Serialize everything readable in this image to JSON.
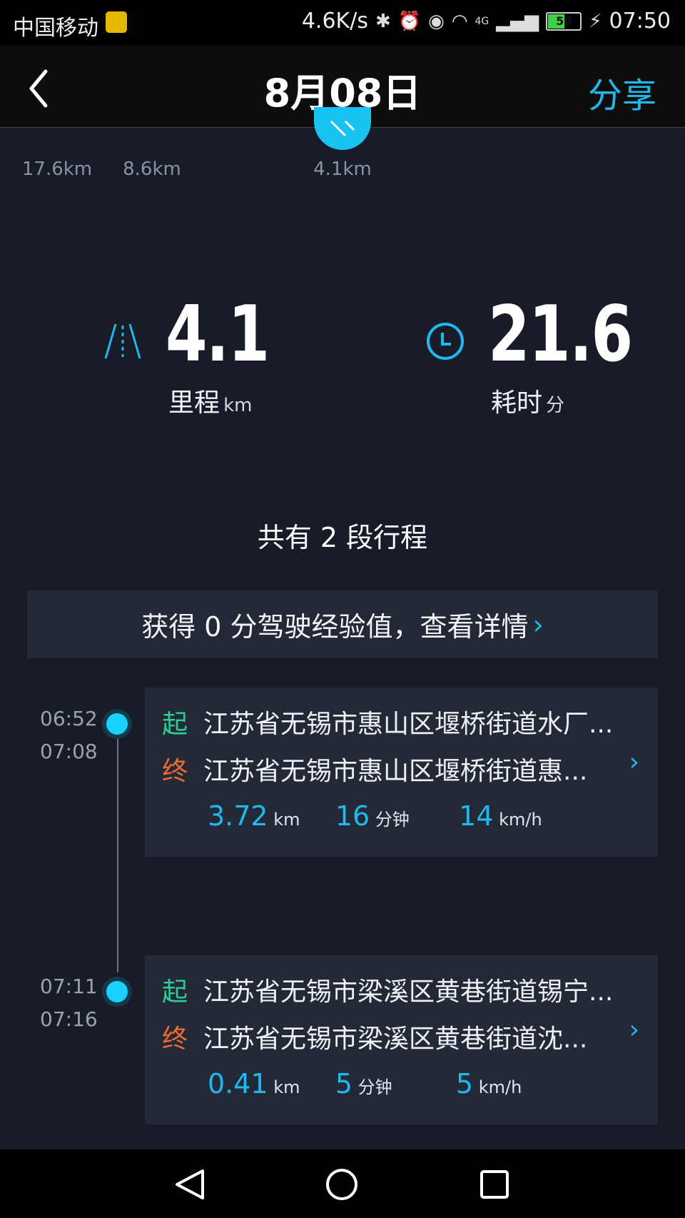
{
  "status_bar": {
    "carrier": "中国移动",
    "speed": "4.6K/s",
    "network": "4G",
    "battery": "50",
    "time": "07:50"
  },
  "header": {
    "title": "8月08日",
    "share_label": "分享"
  },
  "day_strip": [
    {
      "distance": "17.6km"
    },
    {
      "distance": "8.6km"
    },
    {
      "distance": ""
    },
    {
      "distance": "4.1km",
      "selected": true
    }
  ],
  "summary": {
    "distance_value": "4.1",
    "distance_label": "里程",
    "distance_unit": "km",
    "duration_value": "21.6",
    "duration_label": "耗时",
    "duration_unit": "分"
  },
  "segments_text": "共有 2 段行程",
  "experience_text": "获得 0 分驾驶经验值，查看详情",
  "trips": [
    {
      "start_time": "06:52",
      "end_time": "07:08",
      "start_tag": "起",
      "end_tag": "终",
      "start_place": "江苏省无锡市惠山区堰桥街道水厂...",
      "end_place": "江苏省无锡市惠山区堰桥街道惠...",
      "distance": "3.72",
      "distance_unit": "km",
      "duration": "16",
      "duration_unit": "分钟",
      "speed": "14",
      "speed_unit": "km/h"
    },
    {
      "start_time": "07:11",
      "end_time": "07:16",
      "start_tag": "起",
      "end_tag": "终",
      "start_place": "江苏省无锡市梁溪区黄巷街道锡宁...",
      "end_place": "江苏省无锡市梁溪区黄巷街道沈...",
      "distance": "0.41",
      "distance_unit": "km",
      "duration": "5",
      "duration_unit": "分钟",
      "speed": "5",
      "speed_unit": "km/h"
    }
  ],
  "colors": {
    "accent": "#1fb9ee",
    "start_tag": "#2ecf97",
    "end_tag": "#f06c2e",
    "background": "#171c28",
    "card": "#232936"
  }
}
